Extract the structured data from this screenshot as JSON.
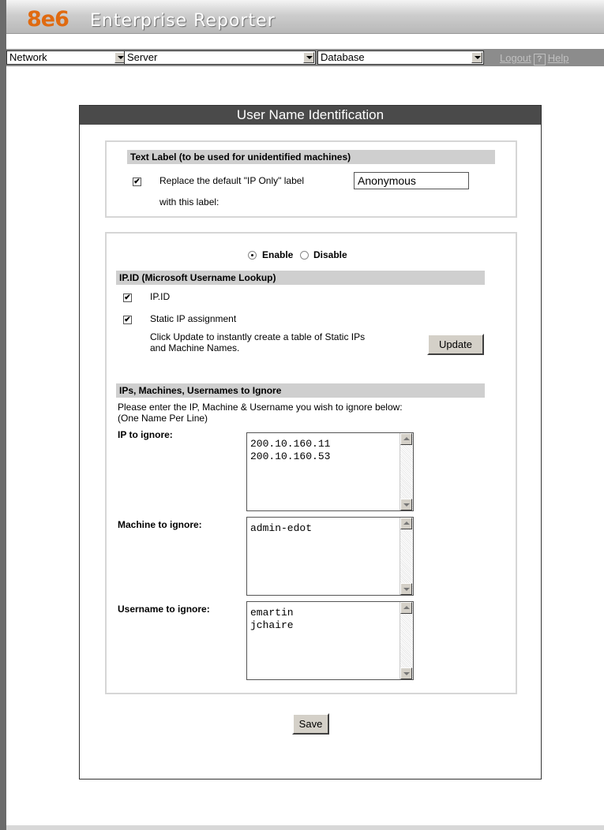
{
  "header": {
    "logo": "8e6",
    "app_title": "Enterprise Reporter"
  },
  "nav": {
    "network_select": "Network",
    "server_select": "Server",
    "database_select": "Database",
    "logout_label": "Logout",
    "help_icon": "?",
    "help_label": "Help"
  },
  "panel": {
    "title": "User Name Identification"
  },
  "text_label": {
    "heading": "Text Label (to be used for unidentified machines)",
    "replace_checked": true,
    "replace_line1": "Replace the default \"IP Only\" label",
    "replace_line2": "with this label:",
    "label_value": "Anonymous"
  },
  "ipid": {
    "enable_label": "Enable",
    "disable_label": "Disable",
    "selected": "Enable",
    "heading": "IP.ID (Microsoft Username Lookup)",
    "ipid_label": "IP.ID",
    "ipid_checked": true,
    "static_label": "Static IP assignment",
    "static_checked": true,
    "update_line1": "Click Update to instantly create a table of Static IPs",
    "update_line2": "and Machine Names.",
    "update_button": "Update"
  },
  "ignore": {
    "heading": "IPs, Machines, Usernames to Ignore",
    "instructions_line1": "Please enter the IP, Machine & Username you wish to ignore below:",
    "instructions_line2": "(One Name Per Line)",
    "ip_label": "IP to ignore:",
    "ip_values": "200.10.160.11\n200.10.160.53",
    "machine_label": "Machine to ignore:",
    "machine_values": "admin-edot",
    "username_label": "Username to ignore:",
    "username_values": "emartin\njchaire"
  },
  "save_button": "Save",
  "icons": {
    "dropdown": "chevron-down-icon",
    "checkbox_mark": "✔",
    "help": "help-icon"
  },
  "colors": {
    "logo_orange": "#e06a10",
    "title_bar": "#4a4a4a",
    "section_bar": "#cfcfcf"
  }
}
